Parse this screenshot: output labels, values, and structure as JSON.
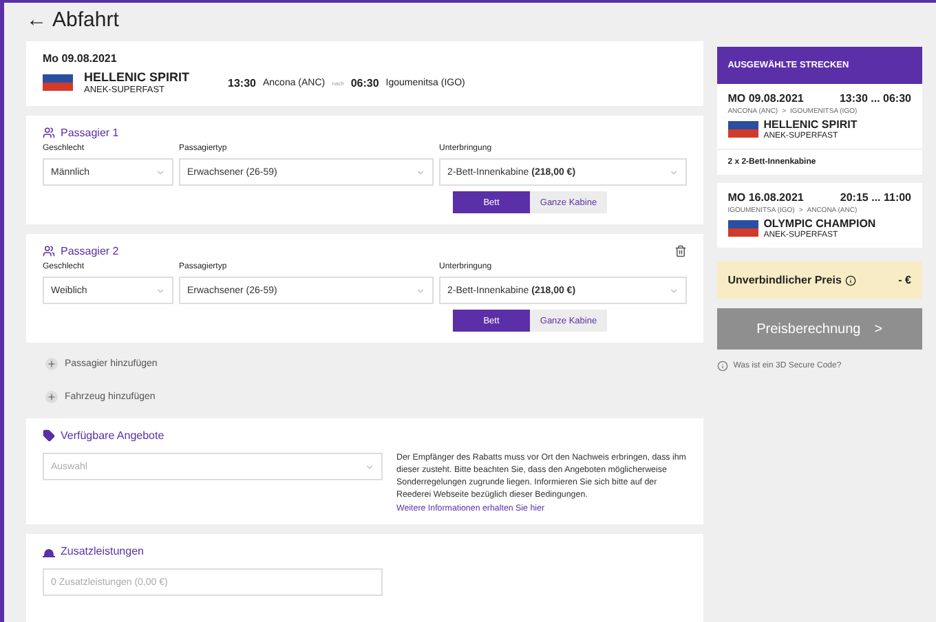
{
  "header": {
    "back": "←",
    "title": "Abfahrt"
  },
  "trip": {
    "date": "Mo 09.08.2021",
    "ship": "HELLENIC SPIRIT",
    "operator": "ANEK-SUPERFAST",
    "dep_time": "13:30",
    "dep_port": "Ancona (ANC)",
    "separator": "nach",
    "arr_time": "06:30",
    "arr_port": "Igoumenitsa (IGO)"
  },
  "passengers": [
    {
      "title": "Passagier 1",
      "deletable": false,
      "gender_label": "Geschlecht",
      "gender": "Männlich",
      "type_label": "Passagiertyp",
      "type": "Erwachsener (26-59)",
      "accommodation_label": "Unterbringung",
      "accommodation": "2-Bett-Innenkabine **(218,00 €)**",
      "options": [
        {
          "label": "Bett",
          "selected": true
        },
        {
          "label": "Ganze Kabine",
          "selected": false
        }
      ]
    },
    {
      "title": "Passagier 2",
      "deletable": true,
      "gender_label": "Geschlecht",
      "gender": "Weiblich",
      "type_label": "Passagiertyp",
      "type": "Erwachsener (26-59)",
      "accommodation_label": "Unterbringung",
      "accommodation": "2-Bett-Innenkabine **(218,00 €)**",
      "options": [
        {
          "label": "Bett",
          "selected": true
        },
        {
          "label": "Ganze Kabine",
          "selected": false
        }
      ]
    }
  ],
  "add_links": [
    "Passagier hinzufügen",
    "Fahrzeug hinzufügen"
  ],
  "offers": {
    "title": "Verfügbare Angebote",
    "placeholder": "Auswahl",
    "note": "Der Empfänger des Rabatts muss vor Ort den Nachweis erbringen, dass ihm dieser zusteht. Bitte beachten Sie, dass den Angeboten möglicherweise Sonderregelungen zugrunde liegen. Informieren Sie sich bitte auf der Reederei Webseite bezüglich dieser Bedingungen.",
    "link": "Weitere Informationen erhalten Sie hier"
  },
  "extras": {
    "title": "Zusatzleistungen",
    "placeholder": "0 Zusatzleistungen (0,00 €)"
  },
  "sidebar": {
    "title": "AUSGEWÄHLTE STRECKEN",
    "routes": [
      {
        "date": "MO 09.08.2021",
        "times": "13:30 ... 06:30",
        "from": "ANCONA (ANC)",
        "arrow": ">",
        "to": "IGOUMENITSA (IGO)",
        "ship": "HELLENIC SPIRIT",
        "operator": "ANEK-SUPERFAST",
        "cabin": "2 x 2-Bett-Innenkabine"
      },
      {
        "date": "MO 16.08.2021",
        "times": "20:15 ... 11:00",
        "from": "IGOUMENITSA (IGO)",
        "arrow": ">",
        "to": "ANCONA (ANC)",
        "ship": "OLYMPIC CHAMPION",
        "operator": "ANEK-SUPERFAST"
      }
    ],
    "price_label": "Unverbindlicher Preis",
    "price": "- €",
    "button": "Preisberechnung",
    "button_arrow": ">",
    "button_disabled": true,
    "secure": "Was ist ein 3D Secure Code?"
  }
}
